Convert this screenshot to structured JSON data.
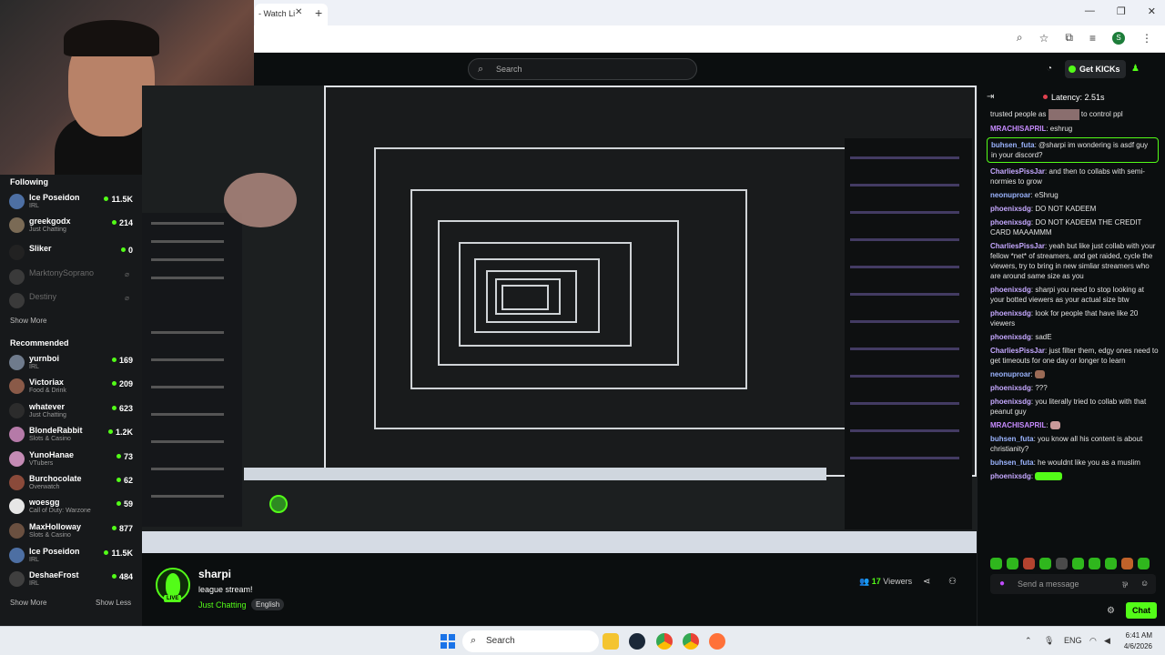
{
  "browser": {
    "tab_title": "- Watch Li",
    "tab_close": "✕",
    "new_tab": "+"
  },
  "header": {
    "search_placeholder": "Search",
    "get_kicks": "Get KICKs"
  },
  "sidebar": {
    "following_heading": "Following",
    "following": [
      {
        "name": "Ice Poseidon",
        "category": "IRL",
        "viewers": "11.5K",
        "live": true
      },
      {
        "name": "greekgodx",
        "category": "Just Chatting",
        "viewers": "214",
        "live": true
      },
      {
        "name": "Sliker",
        "category": "",
        "viewers": "0",
        "live": true
      },
      {
        "name": "MarktonySoprano",
        "category": "",
        "viewers": "",
        "live": false
      },
      {
        "name": "Destiny",
        "category": "",
        "viewers": "",
        "live": false
      }
    ],
    "show_more": "Show More",
    "recommended_heading": "Recommended",
    "recommended": [
      {
        "name": "yurnboi",
        "category": "IRL",
        "viewers": "169"
      },
      {
        "name": "Victoriax",
        "category": "Food & Drink",
        "viewers": "209"
      },
      {
        "name": "whatever",
        "category": "Just Chatting",
        "viewers": "623"
      },
      {
        "name": "BlondeRabbit",
        "category": "Slots & Casino",
        "viewers": "1.2K"
      },
      {
        "name": "YunoHanae",
        "category": "VTubers",
        "viewers": "73"
      },
      {
        "name": "Burchocolate",
        "category": "Overwatch",
        "viewers": "62"
      },
      {
        "name": "woesgg",
        "category": "Call of Duty: Warzone",
        "viewers": "59"
      },
      {
        "name": "MaxHolloway",
        "category": "Slots & Casino",
        "viewers": "877"
      },
      {
        "name": "Ice Poseidon",
        "category": "IRL",
        "viewers": "11.5K"
      },
      {
        "name": "DeshaeFrost",
        "category": "IRL",
        "viewers": "484"
      }
    ],
    "show_more_2": "Show More",
    "show_less": "Show Less"
  },
  "stream": {
    "streamer": "sharpi",
    "live_label": "LIVE",
    "title": "league stream!",
    "category": "Just Chatting",
    "language": "English",
    "viewer_count": "17",
    "viewer_label": "Viewers"
  },
  "chat": {
    "latency": "Latency: 2.51s",
    "messages": [
      {
        "user": "",
        "text": "trusted people as",
        "text2": "to control ppl",
        "color": "",
        "has_img": true
      },
      {
        "user": "MRACHISAPRIL",
        "text": ": eshrug",
        "color": "m"
      },
      {
        "user": "buhsen_futa",
        "text": ": @sharpi im wondering is asdf guy in your discord?",
        "color": "b",
        "highlight": true
      },
      {
        "user": "CharliesPissJar",
        "text": ": and then to collabs with semi-normies to grow",
        "color": "p"
      },
      {
        "user": "neonuproar",
        "text": ": eShrug",
        "color": "b"
      },
      {
        "user": "phoenixsdg",
        "text": ": DO NOT KADEEM",
        "color": "p"
      },
      {
        "user": "phoenixsdg",
        "text": ": DO NOT KADEEM THE CREDIT CARD MAAAMMM",
        "color": "p"
      },
      {
        "user": "CharliesPissJar",
        "text": ": yeah but like just collab with your fellow *net* of streamers, and get raided, cycle the viewers, try to bring in new simliar streamers who are around same size as you",
        "color": "p"
      },
      {
        "user": "phoenixsdg",
        "text": ": sharpi you need to stop looking at your botted viewers as your actual size btw",
        "color": "p"
      },
      {
        "user": "phoenixsdg",
        "text": ": look for people that have like 20 viewers",
        "color": "p"
      },
      {
        "user": "phoenixsdg",
        "text": ": sadE",
        "color": "p"
      },
      {
        "user": "CharliesPissJar",
        "text": ": just filter them, edgy ones need to get timeouts for one day or longer to learn",
        "color": "p"
      },
      {
        "user": "neonuproar",
        "text": ":",
        "color": "b",
        "has_emote": true
      },
      {
        "user": "phoenixsdg",
        "text": ": ???",
        "color": "p"
      },
      {
        "user": "phoenixsdg",
        "text": ": you literally tried to collab with that peanut guy",
        "color": "p"
      },
      {
        "user": "MRACHISAPRIL",
        "text": ":",
        "color": "m",
        "has_emote": true
      },
      {
        "user": "buhsen_futa",
        "text": ": you know all his content is about christianity?",
        "color": "b"
      },
      {
        "user": "buhsen_futa",
        "text": ": he wouldnt like you as a muslim",
        "color": "b"
      },
      {
        "user": "phoenixsdg",
        "text": ":",
        "color": "p",
        "has_emote": true
      }
    ],
    "input_placeholder": "Send a message",
    "chat_button": "Chat"
  },
  "taskbar": {
    "search": "Search",
    "lang": "ENG",
    "time": "6:41 AM",
    "date": "4/6/2026"
  },
  "colors": {
    "accent": "#53fc18",
    "bg": "#0b0e0f",
    "panel": "#17191b"
  }
}
